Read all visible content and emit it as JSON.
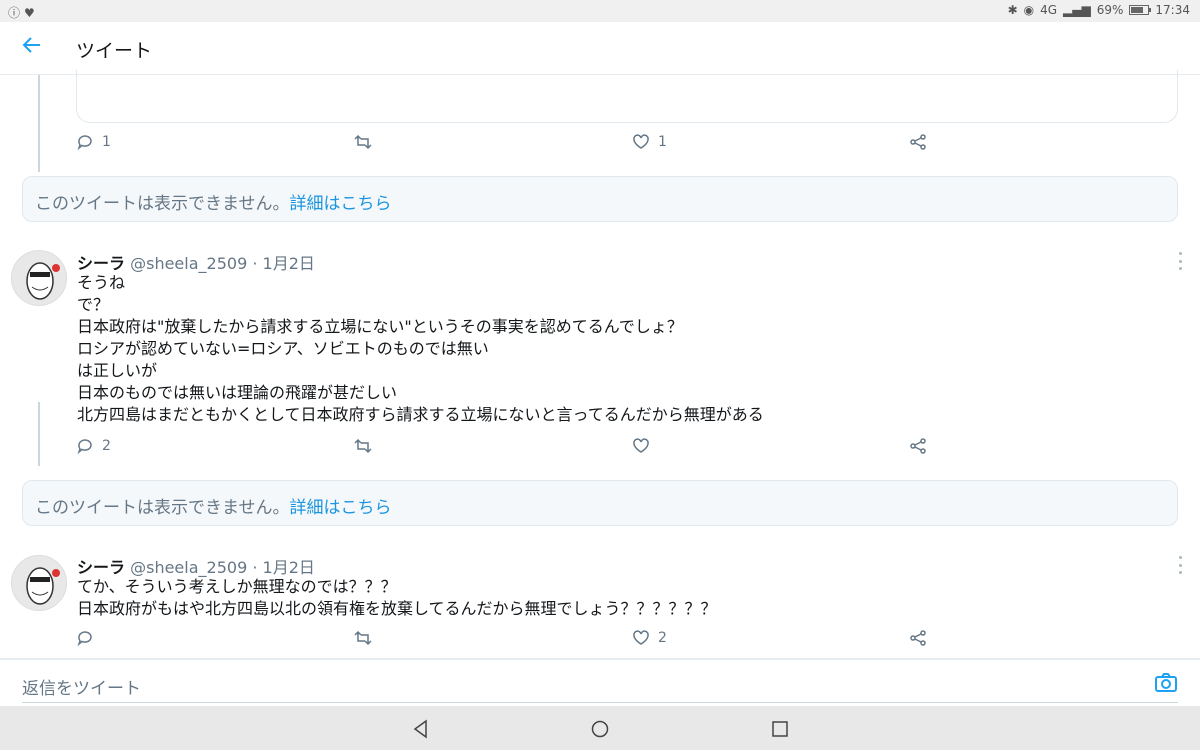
{
  "status_bar": {
    "battery": "69%",
    "time": "17:34",
    "network": "4G"
  },
  "header": {
    "title": "ツイート"
  },
  "tweets_top": {
    "reply_count": "1",
    "retweet_count": "",
    "like_count": "1"
  },
  "unavailable_notice": {
    "text": "このツイートは表示できません。",
    "link": "詳細はこちら"
  },
  "tweets": [
    {
      "name": "シーラ",
      "handle": "@sheela_2509",
      "date": " · 1月2日",
      "lines": [
        "そうね",
        "で？",
        "日本政府は\"放棄したから請求する立場にない\"というその事実を認めてるんでしょ？",
        "ロシアが認めていない=ロシア、ソビエトのものでは無い",
        "は正しいが",
        "日本のものでは無いは理論の飛躍が甚だしい",
        "北方四島はまだともかくとして日本政府すら請求する立場にないと言ってるんだから無理がある"
      ],
      "reply_count": "2",
      "retweet_count": "",
      "like_count": ""
    },
    {
      "name": "シーラ",
      "handle": "@sheela_2509",
      "date": " · 1月2日",
      "lines": [
        "てか、そういう考えしか無理なのでは？？？",
        "日本政府がもはや北方四島以北の領有権を放棄してるんだから無理でしょう？？？？？？"
      ],
      "reply_count": "",
      "retweet_count": "",
      "like_count": "2"
    }
  ],
  "reply_bar": {
    "placeholder": "返信をツイート"
  },
  "icons": {
    "back": "arrow-left-icon",
    "reply": "reply-bubble-icon",
    "retweet": "retweet-icon",
    "like": "heart-icon",
    "share": "share-icon",
    "more": "more-vertical-icon",
    "camera": "camera-icon"
  },
  "colors": {
    "accent": "#1da1f2",
    "link": "#1b95e0",
    "muted": "#657786",
    "notice_bg": "#f5f8fa"
  }
}
